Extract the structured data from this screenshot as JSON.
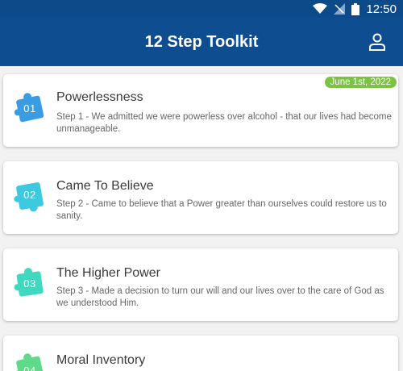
{
  "status_bar": {
    "time": "12:50"
  },
  "app_bar": {
    "title": "12 Step Toolkit"
  },
  "steps": [
    {
      "number": "01",
      "title": "Powerlessness",
      "description": "Step 1 - We admitted we were powerless over alcohol - that our lives had become unmanageable.",
      "badge": "June 1st, 2022",
      "color": "#3a9de3"
    },
    {
      "number": "02",
      "title": "Came To Believe",
      "description": "Step 2 - Came to believe that a Power greater than ourselves could restore us to sanity.",
      "color": "#3ec9e0"
    },
    {
      "number": "03",
      "title": "The Higher Power",
      "description": "Step 3 - Made a decision to turn our will and our lives over to the care of God as we understood Him.",
      "color": "#3fd9c2"
    },
    {
      "number": "04",
      "title": "Moral Inventory",
      "description": "",
      "color": "#5fd98a"
    }
  ]
}
